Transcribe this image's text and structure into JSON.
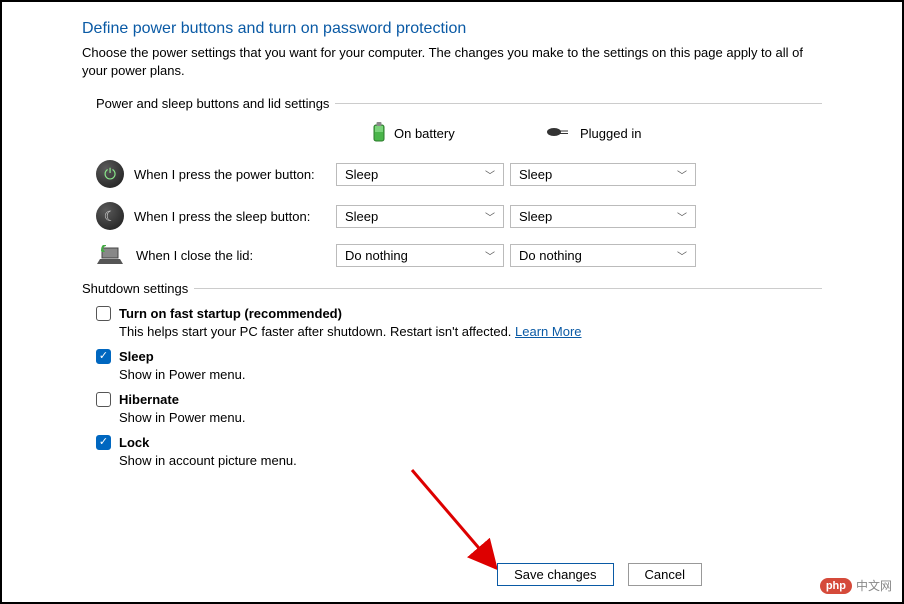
{
  "title": "Define power buttons and turn on password protection",
  "subtitle": "Choose the power settings that you want for your computer. The changes you make to the settings on this page apply to all of your power plans.",
  "sections": {
    "buttons_lid": {
      "header": "Power and sleep buttons and lid settings",
      "columns": {
        "battery": "On battery",
        "plugged": "Plugged in"
      },
      "rows": {
        "power": {
          "label": "When I press the power button:",
          "battery": "Sleep",
          "plugged": "Sleep"
        },
        "sleep": {
          "label": "When I press the sleep button:",
          "battery": "Sleep",
          "plugged": "Sleep"
        },
        "lid": {
          "label": "When I close the lid:",
          "battery": "Do nothing",
          "plugged": "Do nothing"
        }
      }
    },
    "shutdown": {
      "header": "Shutdown settings",
      "items": {
        "fast_startup": {
          "checked": false,
          "label": "Turn on fast startup (recommended)",
          "desc": "This helps start your PC faster after shutdown. Restart isn't affected. ",
          "link": "Learn More"
        },
        "sleep": {
          "checked": true,
          "label": "Sleep",
          "desc": "Show in Power menu."
        },
        "hibernate": {
          "checked": false,
          "label": "Hibernate",
          "desc": "Show in Power menu."
        },
        "lock": {
          "checked": true,
          "label": "Lock",
          "desc": "Show in account picture menu."
        }
      }
    }
  },
  "buttons": {
    "save": "Save changes",
    "cancel": "Cancel"
  },
  "watermark": {
    "php": "php",
    "cn": "中文网"
  }
}
